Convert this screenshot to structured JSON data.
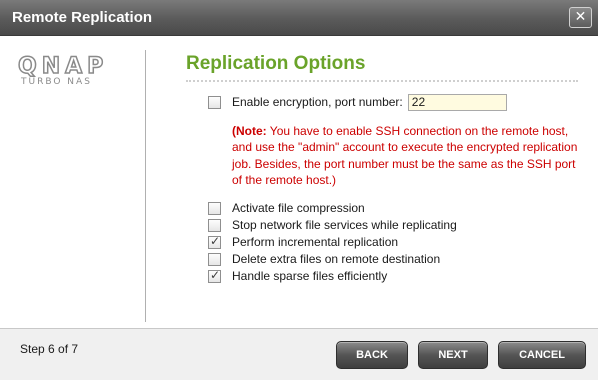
{
  "window": {
    "title": "Remote Replication",
    "close_glyph": "✕"
  },
  "logo": {
    "brand": "QNAP",
    "tagline": "Turbo NAS"
  },
  "page": {
    "heading": "Replication Options",
    "heading_color": "#6aa32a"
  },
  "encryption": {
    "label": "Enable encryption, port number:",
    "checked": false,
    "port_value": "22"
  },
  "note": {
    "prefix": "(Note:",
    "text": " You have to enable SSH connection on the remote host, and use the \"admin\" account to execute the encrypted replication job. Besides, the port number must be the same as the SSH port of the remote host.)",
    "color": "#cc0000"
  },
  "options": [
    {
      "label": "Activate file compression",
      "checked": false
    },
    {
      "label": "Stop network file services while replicating",
      "checked": false
    },
    {
      "label": "Perform incremental replication",
      "checked": true
    },
    {
      "label": "Delete extra files on remote destination",
      "checked": false
    },
    {
      "label": "Handle sparse files efficiently",
      "checked": true
    }
  ],
  "footer": {
    "step": "Step 6 of 7",
    "back_label": "BACK",
    "next_label": "NEXT",
    "cancel_label": "CANCEL"
  }
}
